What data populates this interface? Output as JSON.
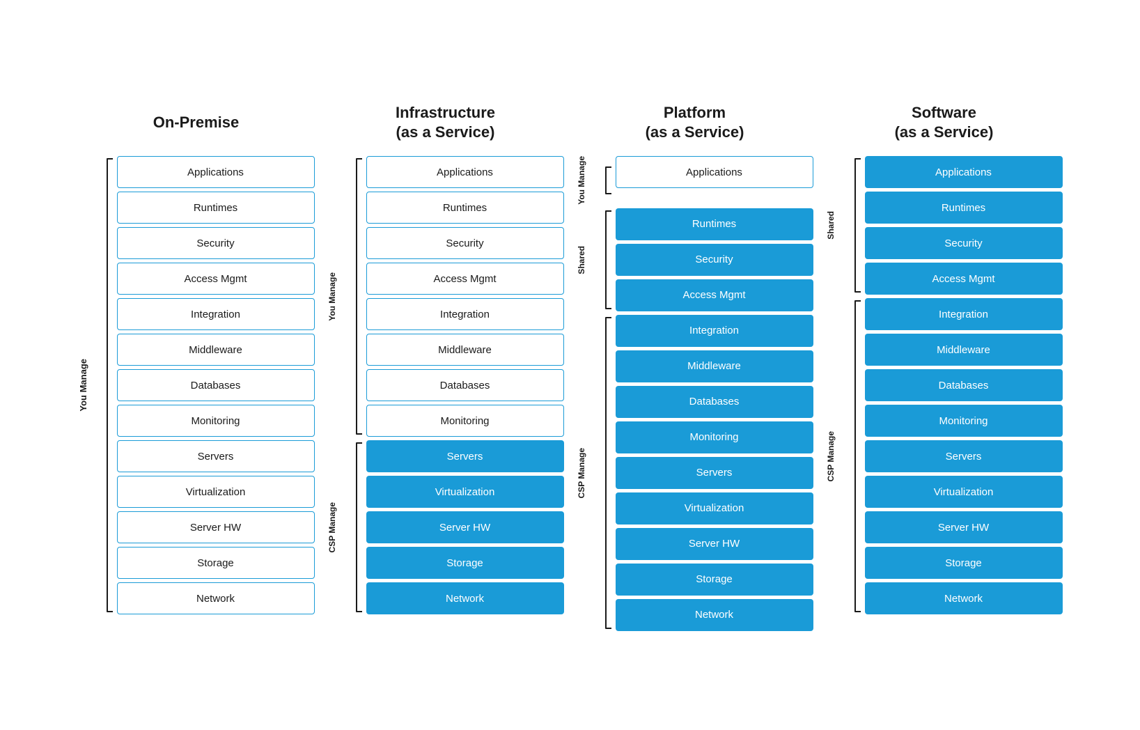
{
  "columns": [
    {
      "id": "on-premise",
      "title": "On-Premise",
      "titleLine2": "",
      "sections": [
        {
          "label": "You Manage",
          "bracketType": "single",
          "items": [
            {
              "label": "Applications",
              "style": "outlined"
            },
            {
              "label": "Runtimes",
              "style": "outlined"
            },
            {
              "label": "Security",
              "style": "outlined"
            },
            {
              "label": "Access Mgmt",
              "style": "outlined"
            },
            {
              "label": "Integration",
              "style": "outlined"
            },
            {
              "label": "Middleware",
              "style": "outlined"
            },
            {
              "label": "Databases",
              "style": "outlined"
            },
            {
              "label": "Monitoring",
              "style": "outlined"
            },
            {
              "label": "Servers",
              "style": "outlined"
            },
            {
              "label": "Virtualization",
              "style": "outlined"
            },
            {
              "label": "Server HW",
              "style": "outlined"
            },
            {
              "label": "Storage",
              "style": "outlined"
            },
            {
              "label": "Network",
              "style": "outlined"
            }
          ]
        }
      ]
    },
    {
      "id": "iaas",
      "title": "Infrastructure\n(as a Service)",
      "titleLine2": "(as a Service)",
      "sections": [
        {
          "label": "You Manage",
          "bracketType": "top",
          "items": [
            {
              "label": "Applications",
              "style": "outlined"
            },
            {
              "label": "Runtimes",
              "style": "outlined"
            },
            {
              "label": "Security",
              "style": "outlined"
            },
            {
              "label": "Access Mgmt",
              "style": "outlined"
            },
            {
              "label": "Integration",
              "style": "outlined"
            },
            {
              "label": "Middleware",
              "style": "outlined"
            },
            {
              "label": "Databases",
              "style": "outlined"
            },
            {
              "label": "Monitoring",
              "style": "outlined"
            }
          ]
        },
        {
          "label": "CSP Manage",
          "bracketType": "bottom",
          "items": [
            {
              "label": "Servers",
              "style": "filled"
            },
            {
              "label": "Virtualization",
              "style": "filled"
            },
            {
              "label": "Server HW",
              "style": "filled"
            },
            {
              "label": "Storage",
              "style": "filled"
            },
            {
              "label": "Network",
              "style": "filled"
            }
          ]
        }
      ]
    },
    {
      "id": "paas",
      "title": "Platform\n(as a Service)",
      "titleLine2": "(as a Service)",
      "sections": [
        {
          "label": "You Manage",
          "bracketType": "top-small",
          "items": [
            {
              "label": "Applications",
              "style": "outlined"
            }
          ]
        },
        {
          "label": "Shared",
          "bracketType": "mid",
          "items": [
            {
              "label": "Runtimes",
              "style": "filled"
            },
            {
              "label": "Security",
              "style": "filled"
            },
            {
              "label": "Access Mgmt",
              "style": "filled"
            }
          ]
        },
        {
          "label": "CSP Manage",
          "bracketType": "bottom",
          "items": [
            {
              "label": "Integration",
              "style": "filled"
            },
            {
              "label": "Middleware",
              "style": "filled"
            },
            {
              "label": "Databases",
              "style": "filled"
            },
            {
              "label": "Monitoring",
              "style": "filled"
            },
            {
              "label": "Servers",
              "style": "filled"
            },
            {
              "label": "Virtualization",
              "style": "filled"
            },
            {
              "label": "Server HW",
              "style": "filled"
            },
            {
              "label": "Storage",
              "style": "filled"
            },
            {
              "label": "Network",
              "style": "filled"
            }
          ]
        }
      ]
    },
    {
      "id": "saas",
      "title": "Software\n(as a Service)",
      "titleLine2": "(as a Service)",
      "sections": [
        {
          "label": "Shared",
          "bracketType": "top",
          "items": [
            {
              "label": "Applications",
              "style": "filled"
            },
            {
              "label": "Runtimes",
              "style": "filled"
            },
            {
              "label": "Security",
              "style": "filled"
            },
            {
              "label": "Access Mgmt",
              "style": "filled"
            }
          ]
        },
        {
          "label": "CSP Manage",
          "bracketType": "bottom",
          "items": [
            {
              "label": "Integration",
              "style": "filled"
            },
            {
              "label": "Middleware",
              "style": "filled"
            },
            {
              "label": "Databases",
              "style": "filled"
            },
            {
              "label": "Monitoring",
              "style": "filled"
            },
            {
              "label": "Servers",
              "style": "filled"
            },
            {
              "label": "Virtualization",
              "style": "filled"
            },
            {
              "label": "Server HW",
              "style": "filled"
            },
            {
              "label": "Storage",
              "style": "filled"
            },
            {
              "label": "Network",
              "style": "filled"
            }
          ]
        }
      ]
    }
  ]
}
